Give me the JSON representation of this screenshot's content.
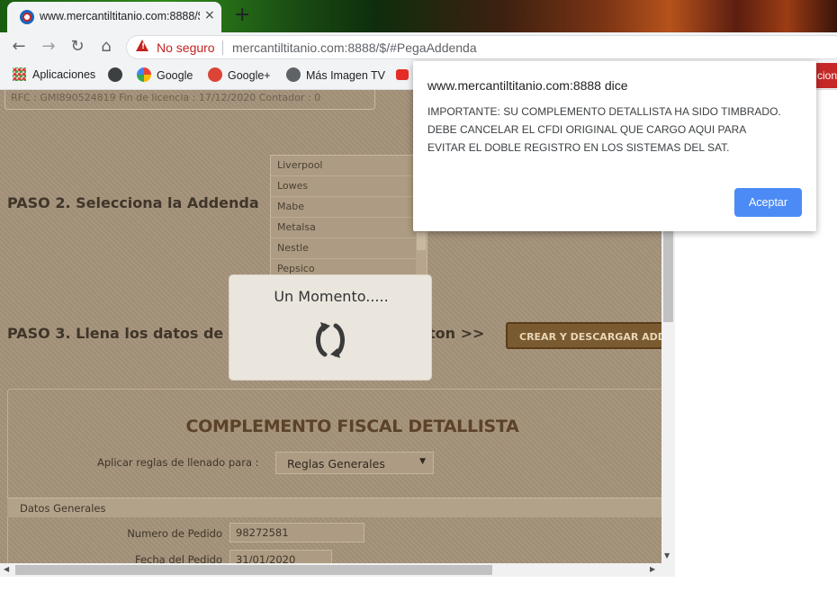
{
  "browser": {
    "tab_title": "www.mercantiltitanio.com:8888/$",
    "tab_close": "×",
    "new_tab": "+",
    "security_label": "No seguro",
    "url": "mercantiltitanio.com:8888/$/#PegaAddenda",
    "bookmarks": [
      {
        "label": "Aplicaciones",
        "icon": "apps-grid-icon"
      },
      {
        "label": "",
        "icon": "globe-icon"
      },
      {
        "label": "Google",
        "icon": "google-icon"
      },
      {
        "label": "Google+",
        "icon": "google-plus-icon"
      },
      {
        "label": "Más Imagen TV",
        "icon": "imagen-tv-icon"
      },
      {
        "label": "",
        "icon": "youtube-icon"
      }
    ],
    "bookmark_overflow": "cion"
  },
  "page": {
    "rfc_bar": "RFC :  GMI890524819     Fin de licencia :  17/12/2020     Contador :   0",
    "step2": "PASO 2. Selecciona la Addenda",
    "addenda_options": [
      "Liverpool",
      "Lowes",
      "Mabe",
      "Metalsa",
      "Nestle",
      "Pepsico"
    ],
    "step3_left": "PASO 3. Llena los datos de la",
    "step3_right": "oton >>",
    "crear_button": "CREAR Y DESCARGAR ADDENDA",
    "complement_title": "COMPLEMENTO FISCAL DETALLISTA",
    "rules_label": "Aplicar reglas de llenado para :",
    "rules_value": "Reglas Generales",
    "datos_generales": "Datos Generales",
    "fields": [
      {
        "label": "Numero de Pedido",
        "value": "98272581"
      },
      {
        "label": "Fecha del Pedido",
        "value": "31/01/2020"
      }
    ]
  },
  "loading": {
    "text": "Un Momento....."
  },
  "dialog": {
    "origin": "www.mercantiltitanio.com:8888 dice",
    "message_lines": [
      "IMPORTANTE: SU COMPLEMENTO DETALLISTA HA SIDO TIMBRADO.",
      "DEBE CANCELAR EL CFDI ORIGINAL QUE CARGO AQUI PARA",
      "EVITAR EL DOBLE REGISTRO EN LOS SISTEMAS DEL SAT."
    ],
    "ok_button": "Aceptar"
  },
  "colors": {
    "accent": "#4c8bf5",
    "warning": "#c5221f",
    "page_bg": "#a4927a"
  }
}
